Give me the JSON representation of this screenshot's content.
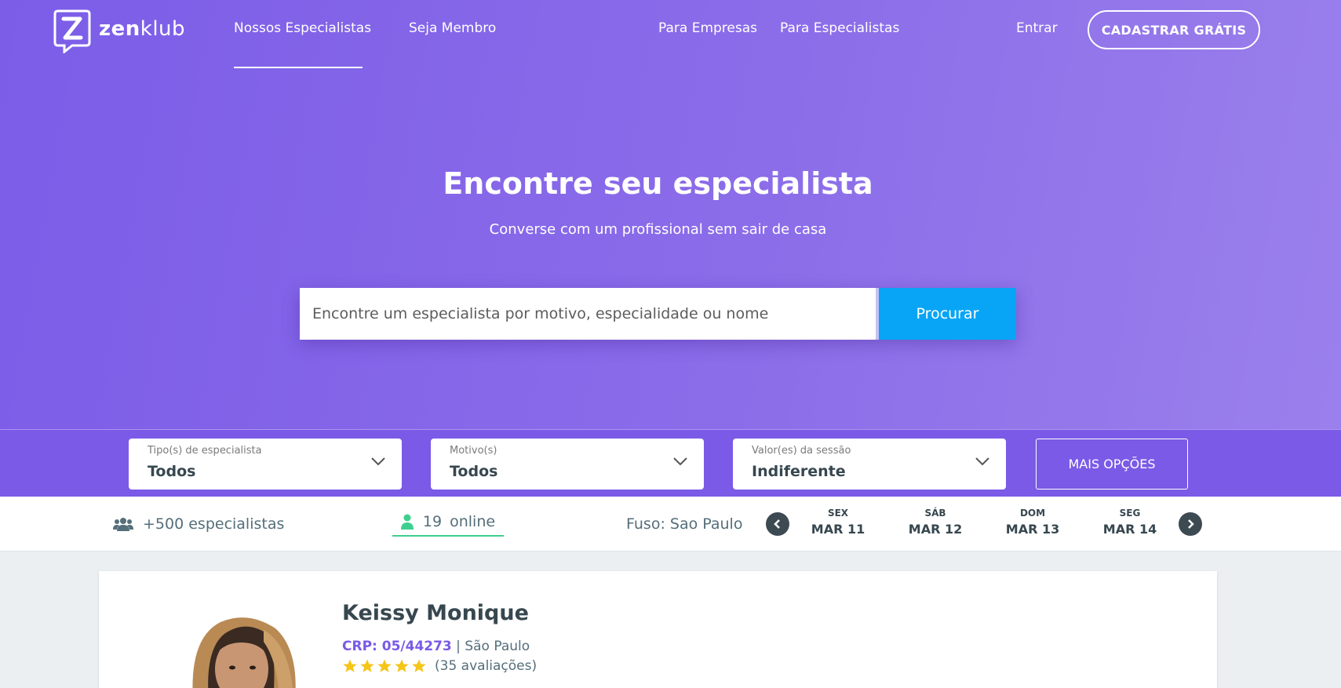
{
  "brand": {
    "logo_text_bold": "zen",
    "logo_text_light": "klub",
    "logo_icon": "z-chat-bubble-icon"
  },
  "nav": {
    "specialists": "Nossos Especialistas",
    "member": "Seja Membro",
    "companies": "Para Empresas",
    "for_specialists": "Para Especialistas",
    "login": "Entrar",
    "signup": "CADASTRAR GRÁTIS"
  },
  "hero": {
    "title": "Encontre seu especialista",
    "subtitle": "Converse com um profissional sem sair de casa"
  },
  "search": {
    "placeholder": "Encontre um especialista por motivo, especialidade ou nome",
    "button": "Procurar"
  },
  "filters": [
    {
      "label": "Tipo(s) de especialista",
      "value": "Todos"
    },
    {
      "label": "Motivo(s)",
      "value": "Todos"
    },
    {
      "label": "Valor(es) da sessão",
      "value": "Indiferente"
    }
  ],
  "more_options": "MAIS OPÇÕES",
  "stats": {
    "specialists_count": "+500 especialistas",
    "online_count": "19",
    "online_label": "online",
    "timezone": "Fuso: Sao Paulo"
  },
  "days": [
    {
      "dow": "SEX",
      "date": "MAR 11"
    },
    {
      "dow": "SÁB",
      "date": "MAR 12"
    },
    {
      "dow": "DOM",
      "date": "MAR 13"
    },
    {
      "dow": "SEG",
      "date": "MAR 14"
    }
  ],
  "specialist": {
    "name": "Keissy Monique",
    "crp": "CRP: 05/44273",
    "separator": "|",
    "city": "São Paulo",
    "rating_stars": 5,
    "reviews": "(35 avaliações)"
  },
  "colors": {
    "hero_start": "#7b5de8",
    "hero_end": "#9a80ec",
    "search_button": "#08a5f6",
    "filter_bar": "#7a5ae6",
    "online_green": "#3ecf8e",
    "star": "#f5c518"
  }
}
